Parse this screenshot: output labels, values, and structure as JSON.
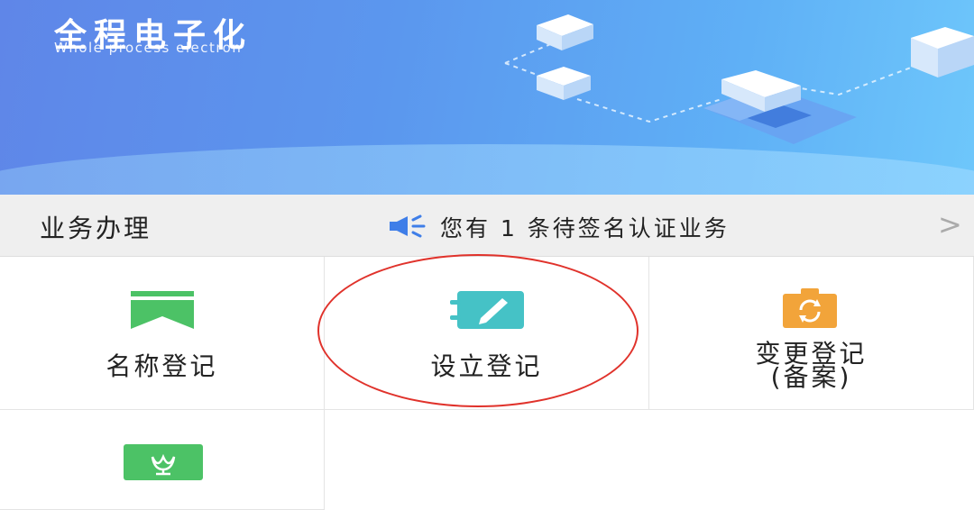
{
  "banner": {
    "title": "全程电子化",
    "subtitle": "Whole process electron"
  },
  "business_bar": {
    "title": "业务办理",
    "notice_icon": "megaphone-icon",
    "notice": "您有 1 条待签名认证业务",
    "chevron": ">"
  },
  "services": [
    {
      "label": "名称登记",
      "icon": "bookmark-icon",
      "color": "#4cc266"
    },
    {
      "label": "设立登记",
      "icon": "notebook-pen-icon",
      "color": "#45c2c6"
    },
    {
      "label_line1": "变更登记",
      "label_line2": "(备案)",
      "icon": "clipboard-refresh-icon",
      "color": "#f2a43a"
    },
    {
      "label": "",
      "icon": "flower-icon",
      "color": "#4cc266"
    }
  ],
  "colors": {
    "banner_start": "#5f86e8",
    "banner_end": "#6ec7fb",
    "highlight": "#e0322b",
    "notice_icon": "#3f7ee8"
  }
}
